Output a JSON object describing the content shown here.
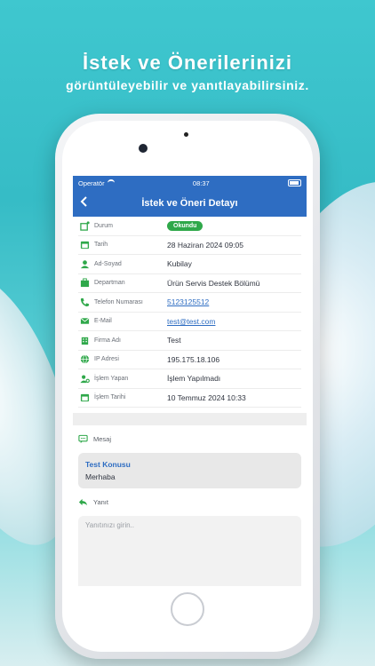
{
  "headline": {
    "title": "İstek ve Önerilerinizi",
    "subtitle": "görüntüleyebilir ve yanıtlayabilirsiniz."
  },
  "statusbar": {
    "operator": "Operatör",
    "time": "08:37"
  },
  "navbar": {
    "title": "İstek ve Öneri Detayı"
  },
  "details": [
    {
      "icon": "status-icon",
      "label": "Durum",
      "value": "Okundu",
      "type": "badge"
    },
    {
      "icon": "calendar-icon",
      "label": "Tarih",
      "value": "28 Haziran 2024 09:05",
      "type": "text"
    },
    {
      "icon": "person-icon",
      "label": "Ad-Soyad",
      "value": "Kubilay",
      "type": "text"
    },
    {
      "icon": "department-icon",
      "label": "Departman",
      "value": "Ürün Servis Destek Bölümü",
      "type": "text"
    },
    {
      "icon": "phone-icon",
      "label": "Telefon Numarası",
      "value": "5123125512",
      "type": "link"
    },
    {
      "icon": "mail-icon",
      "label": "E-Mail",
      "value": "test@test.com",
      "type": "link"
    },
    {
      "icon": "company-icon",
      "label": "Firma Adı",
      "value": "Test",
      "type": "text"
    },
    {
      "icon": "globe-icon",
      "label": "IP Adresi",
      "value": "195.175.18.106",
      "type": "text"
    },
    {
      "icon": "user-gear-icon",
      "label": "İşlem Yapan",
      "value": "İşlem Yapılmadı",
      "type": "text"
    },
    {
      "icon": "calendar-icon",
      "label": "İşlem Tarihi",
      "value": "10 Temmuz 2024 10:33",
      "type": "text"
    }
  ],
  "message_section": {
    "label": "Mesaj",
    "subject": "Test Konusu",
    "body": "Merhaba"
  },
  "reply_section": {
    "label": "Yanıt",
    "placeholder": "Yanıtınızı girin.."
  },
  "colors": {
    "accent": "#2e6dc2",
    "icon_green": "#2fa84a",
    "badge_green": "#2fa84a"
  }
}
